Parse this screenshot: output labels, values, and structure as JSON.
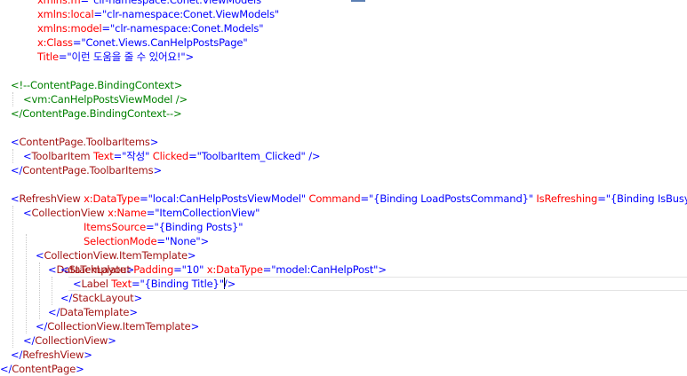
{
  "colors": {
    "tag": "#a31515",
    "attribute": "#ff0000",
    "value": "#0000ff",
    "punctuation": "#0000ff",
    "comment": "#008000",
    "plain": "#000000"
  },
  "editor": {
    "lines": [
      [
        {
          "t": "xmlns:m",
          "c": "attribute"
        },
        {
          "t": "=\"clr-namespace:Conet.ViewModels\"",
          "c": "value"
        }
      ],
      [
        {
          "t": "xmlns:local",
          "c": "attribute"
        },
        {
          "t": "=\"clr-namespace:Conet.ViewModels\"",
          "c": "value"
        }
      ],
      [
        {
          "t": "xmlns:model",
          "c": "attribute"
        },
        {
          "t": "=\"clr-namespace:Conet.Models\"",
          "c": "value"
        }
      ],
      [
        {
          "t": "x:Class",
          "c": "attribute"
        },
        {
          "t": "=\"Conet.Views.CanHelpPostsPage\"",
          "c": "value"
        }
      ],
      [
        {
          "t": "Title",
          "c": "attribute"
        },
        {
          "t": "=\"이런 도움을 줄 수 있어요!\">",
          "c": "value"
        }
      ],
      [],
      [
        {
          "t": "<!--ContentPage.BindingContext>",
          "c": "comment"
        }
      ],
      [
        {
          "t": "<vm:CanHelpPostsViewModel />",
          "c": "comment"
        }
      ],
      [
        {
          "t": "</ContentPage.BindingContext-->",
          "c": "comment"
        }
      ],
      [],
      [
        {
          "t": "<",
          "c": "punctuation"
        },
        {
          "t": "ContentPage.ToolbarItems",
          "c": "tag"
        },
        {
          "t": ">",
          "c": "punctuation"
        }
      ],
      [
        {
          "t": "<",
          "c": "punctuation"
        },
        {
          "t": "ToolbarItem",
          "c": "tag"
        },
        {
          "t": " Text",
          "c": "attribute"
        },
        {
          "t": "=\"작성\"",
          "c": "value"
        },
        {
          "t": " Clicked",
          "c": "attribute"
        },
        {
          "t": "=\"ToolbarItem_Clicked\" />",
          "c": "value"
        }
      ],
      [
        {
          "t": "</",
          "c": "punctuation"
        },
        {
          "t": "ContentPage.ToolbarItems",
          "c": "tag"
        },
        {
          "t": ">",
          "c": "punctuation"
        }
      ],
      [],
      [
        {
          "t": "<",
          "c": "punctuation"
        },
        {
          "t": "RefreshView",
          "c": "tag"
        },
        {
          "t": " x:DataType",
          "c": "attribute"
        },
        {
          "t": "=\"local:CanHelpPostsViewModel\"",
          "c": "value"
        },
        {
          "t": " Command",
          "c": "attribute"
        },
        {
          "t": "=\"{Binding LoadPostsCommand}\"",
          "c": "value"
        },
        {
          "t": " IsRefreshing",
          "c": "attribute"
        },
        {
          "t": "=\"{Binding IsBusy, Mode=Tw",
          "c": "value"
        }
      ],
      [
        {
          "t": "<",
          "c": "punctuation"
        },
        {
          "t": "CollectionView",
          "c": "tag"
        },
        {
          "t": " x:Name",
          "c": "attribute"
        },
        {
          "t": "=\"ItemCollectionView\"",
          "c": "value"
        }
      ],
      [
        {
          "t": "ItemsSource",
          "c": "attribute"
        },
        {
          "t": "=\"{Binding Posts}\"",
          "c": "value"
        }
      ],
      [
        {
          "t": "SelectionMode",
          "c": "attribute"
        },
        {
          "t": "=\"None\">",
          "c": "value"
        }
      ],
      [
        {
          "t": "<",
          "c": "punctuation"
        },
        {
          "t": "CollectionView.ItemTemplate",
          "c": "tag"
        },
        {
          "t": ">",
          "c": "punctuation"
        }
      ],
      [
        {
          "t": "<",
          "c": "punctuation"
        },
        {
          "t": "DataTemplate",
          "c": "tag"
        },
        {
          "t": ">",
          "c": "punctuation"
        }
      ],
      [
        {
          "t": "<",
          "c": "punctuation"
        },
        {
          "t": "StackLayout",
          "c": "tag"
        },
        {
          "t": " Padding",
          "c": "attribute"
        },
        {
          "t": "=\"10\"",
          "c": "value"
        },
        {
          "t": " x:DataType",
          "c": "attribute"
        },
        {
          "t": "=\"model:CanHelpPost\">",
          "c": "value"
        }
      ],
      [
        {
          "t": "<",
          "c": "punctuation"
        },
        {
          "t": "Label",
          "c": "tag"
        },
        {
          "t": " Text",
          "c": "attribute"
        },
        {
          "t": "=\"{Binding Title}\"",
          "c": "value"
        },
        {
          "t": "",
          "c": "caret"
        },
        {
          "t": "/>",
          "c": "value"
        }
      ],
      [
        {
          "t": "</",
          "c": "punctuation"
        },
        {
          "t": "StackLayout",
          "c": "tag"
        },
        {
          "t": ">",
          "c": "punctuation"
        }
      ],
      [
        {
          "t": "</",
          "c": "punctuation"
        },
        {
          "t": "DataTemplate",
          "c": "tag"
        },
        {
          "t": ">",
          "c": "punctuation"
        }
      ],
      [
        {
          "t": "</",
          "c": "punctuation"
        },
        {
          "t": "CollectionView.ItemTemplate",
          "c": "tag"
        },
        {
          "t": ">",
          "c": "punctuation"
        }
      ],
      [
        {
          "t": "</",
          "c": "punctuation"
        },
        {
          "t": "CollectionView",
          "c": "tag"
        },
        {
          "t": ">",
          "c": "punctuation"
        }
      ],
      [
        {
          "t": "</",
          "c": "punctuation"
        },
        {
          "t": "RefreshView",
          "c": "tag"
        },
        {
          "t": ">",
          "c": "punctuation"
        }
      ],
      [
        {
          "t": "</",
          "c": "punctuation"
        },
        {
          "t": "ContentPage",
          "c": "tag"
        },
        {
          "t": ">",
          "c": "punctuation"
        }
      ]
    ]
  }
}
